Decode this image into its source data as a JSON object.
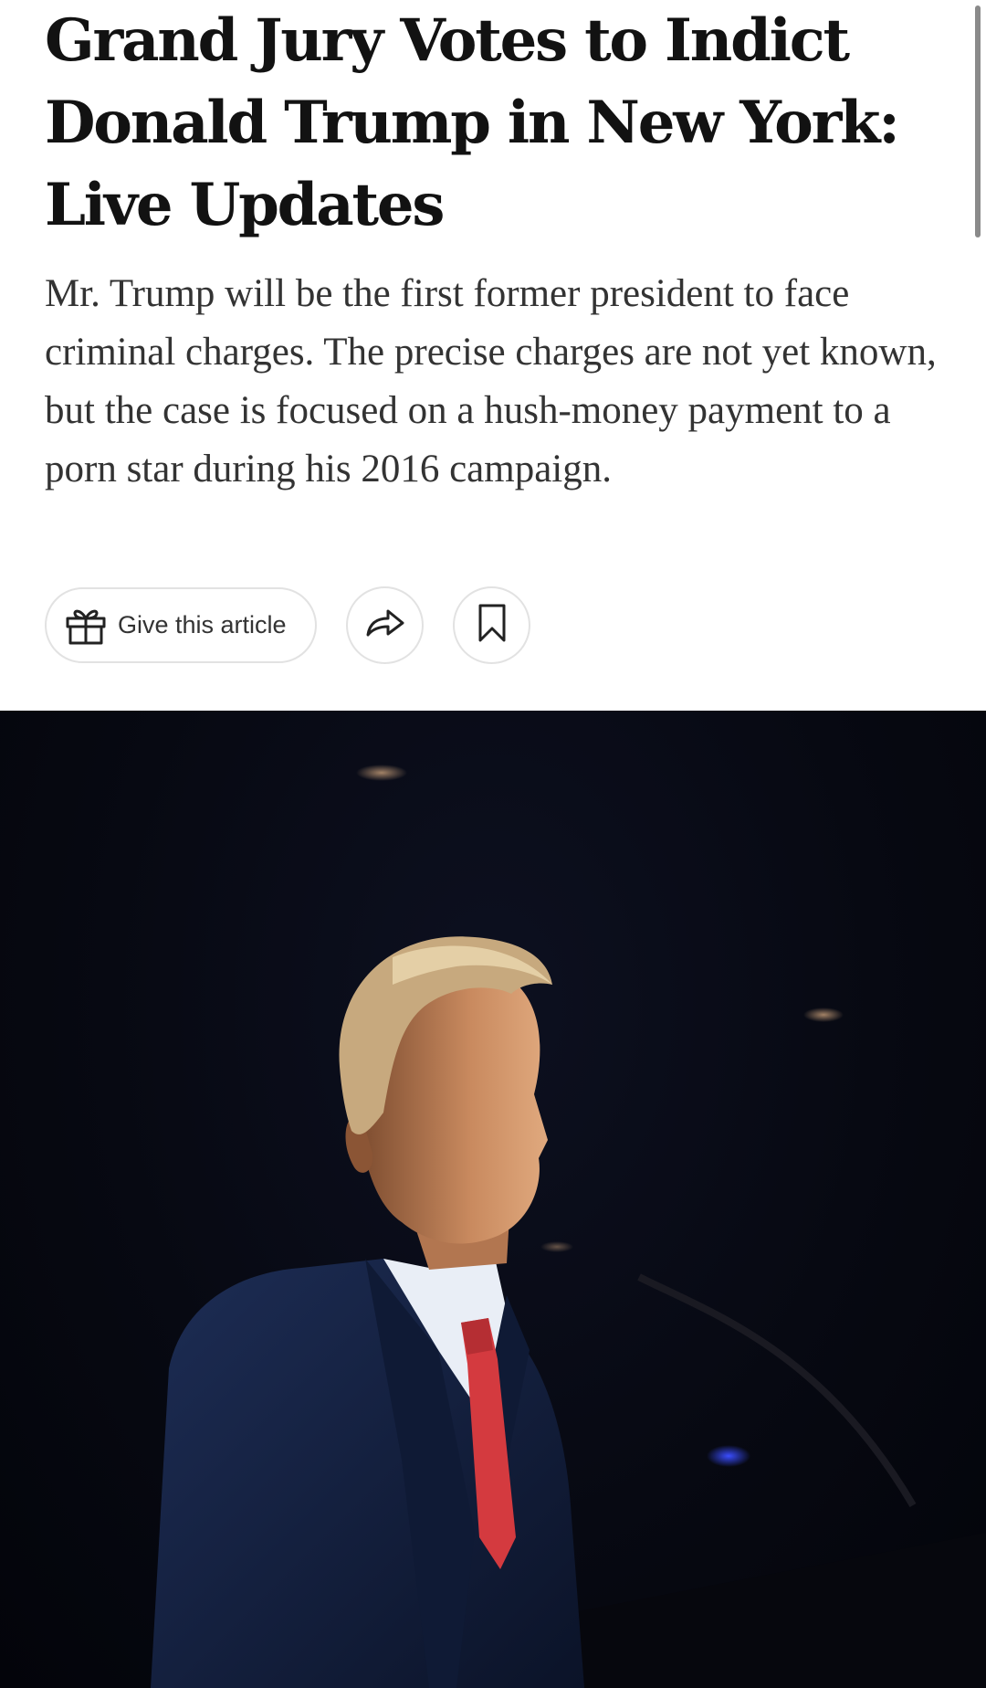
{
  "article": {
    "headline": "Grand Jury Votes to Indict Donald Trump in New York: Live Updates",
    "summary": "Mr. Trump will be the first former president to face criminal charges. The precise charges are not yet known, but the case is focused on a hush-money payment to a porn star during his 2016 campaign."
  },
  "actions": {
    "gift_label": "Give this article",
    "gift_icon": "gift-icon",
    "share_icon": "share-arrow-icon",
    "save_icon": "bookmark-icon"
  },
  "colors": {
    "text": "#121212",
    "summary_text": "#333333",
    "button_border": "#e2e2e2",
    "photo_background": "#070912"
  }
}
